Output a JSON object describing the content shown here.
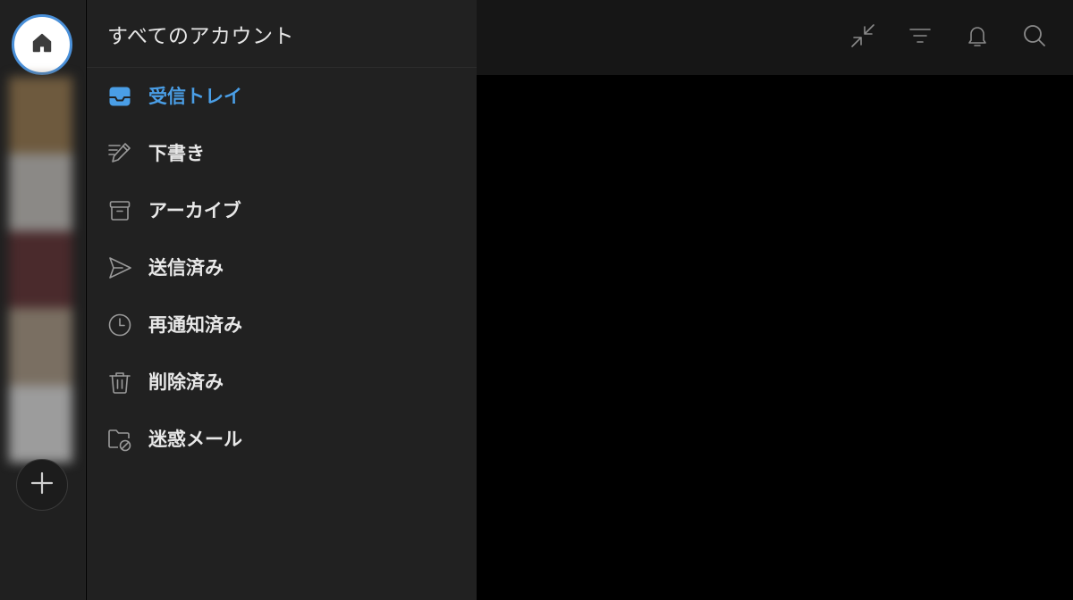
{
  "rail": {
    "avatar_colors": [
      "#6e5a3e",
      "#8b8986",
      "#4a2a2c",
      "#7a6f62",
      "#9c9c9c"
    ]
  },
  "panel": {
    "title": "すべてのアカウント",
    "folders": [
      {
        "label": "受信トレイ",
        "icon": "inbox-icon",
        "active": true
      },
      {
        "label": "下書き",
        "icon": "pencil-icon",
        "active": false
      },
      {
        "label": "アーカイブ",
        "icon": "archive-icon",
        "active": false
      },
      {
        "label": "送信済み",
        "icon": "send-icon",
        "active": false
      },
      {
        "label": "再通知済み",
        "icon": "clock-icon",
        "active": false
      },
      {
        "label": "削除済み",
        "icon": "trash-icon",
        "active": false
      },
      {
        "label": "迷惑メール",
        "icon": "spam-folder-icon",
        "active": false
      }
    ]
  },
  "toolbar": {
    "icons": [
      "collapse-icon",
      "filter-icon",
      "bell-icon",
      "search-icon"
    ]
  },
  "colors": {
    "accent": "#4a9ee6",
    "home_ring": "#4a90d9",
    "panel_bg": "#212121",
    "rail_bg": "#202020",
    "toolbar_bg": "#161616"
  }
}
